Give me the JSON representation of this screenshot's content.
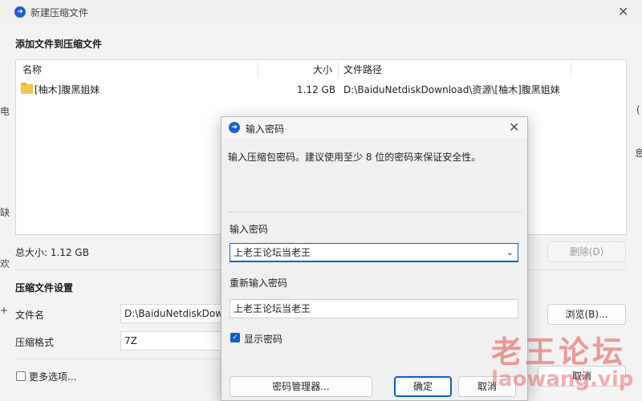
{
  "window": {
    "title": "新建压缩文件",
    "add_section_title": "添加文件到压缩文件",
    "columns": {
      "name": "名称",
      "size": "大小",
      "path": "文件路径"
    },
    "files": [
      {
        "name": "[柚木]腹黑姐妹",
        "size": "1.12 GB",
        "path": "D:\\BaiduNetdiskDownload\\资源\\[柚木]腹黑姐妹"
      }
    ],
    "total_size": "总大小: 1.12 GB",
    "delete_button": "删除(D)",
    "settings_title": "压缩文件设置",
    "filename_label": "文件名",
    "filename_value": "D:\\BaiduNetdiskDownload",
    "browse_button": "浏览(B)...",
    "format_label": "压缩格式",
    "format_value": "7Z",
    "more_options": "更多选项...",
    "cancel_button": "取消"
  },
  "dialog": {
    "title": "输入密码",
    "description": "输入压缩包密码。建议使用至少 8 位的密码来保证安全性。",
    "password_label": "输入密码",
    "password_value": "上老王论坛当老王",
    "repeat_label": "重新输入密码",
    "repeat_value": "上老王论坛当老王",
    "show_password_label": "显示密码",
    "show_password_checked": true,
    "manager_button": "密码管理器...",
    "ok_button": "确定",
    "cancel_button": "取消"
  },
  "watermark": {
    "text": "老王论坛",
    "url": "laowang.vip"
  },
  "edge_fragments": {
    "left_1": "电",
    "left_2": "缺",
    "left_3": "欢",
    "left_4": "+",
    "right_1": "(",
    "right_2": "息"
  },
  "colors": {
    "accent": "#0a62c4",
    "app_icon": "#1f5fd1",
    "folder": "#f4c84d"
  }
}
